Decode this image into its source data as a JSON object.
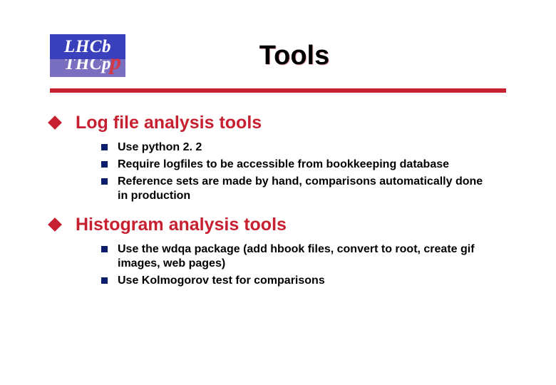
{
  "logo": {
    "line1": "LHCb",
    "line2": "THCp",
    "overlay": "p"
  },
  "title": "Tools",
  "sections": [
    {
      "heading": "Log file analysis tools",
      "items": [
        "Use python 2. 2",
        "Require logfiles to be accessible from bookkeeping database",
        "Reference sets are made by hand, comparisons automatically done in production"
      ]
    },
    {
      "heading": "Histogram analysis tools",
      "items": [
        "Use the wdqa package (add hbook files, convert to root, create gif images, web pages)",
        "Use Kolmogorov test for comparisons"
      ]
    }
  ]
}
